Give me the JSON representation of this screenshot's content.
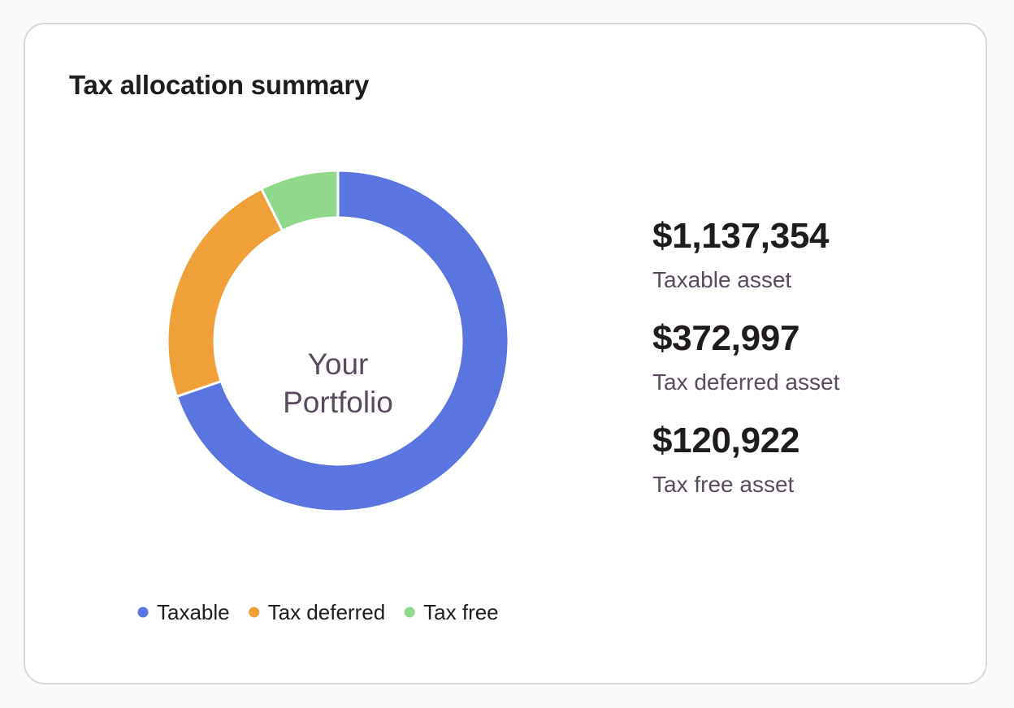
{
  "card": {
    "title": "Tax allocation summary"
  },
  "chart_data": {
    "type": "pie",
    "variant": "donut",
    "center_text": [
      "Your",
      "Portfolio"
    ],
    "categories": [
      "Taxable",
      "Tax deferred",
      "Tax free"
    ],
    "values": [
      1137354,
      372997,
      120922
    ],
    "colors": [
      "#5a74e0",
      "#f0a038",
      "#90d98c"
    ],
    "legend_position": "bottom"
  },
  "stats": [
    {
      "value": "$1,137,354",
      "label": "Taxable asset"
    },
    {
      "value": "$372,997",
      "label": "Tax deferred asset"
    },
    {
      "value": "$120,922",
      "label": "Tax free asset"
    }
  ]
}
